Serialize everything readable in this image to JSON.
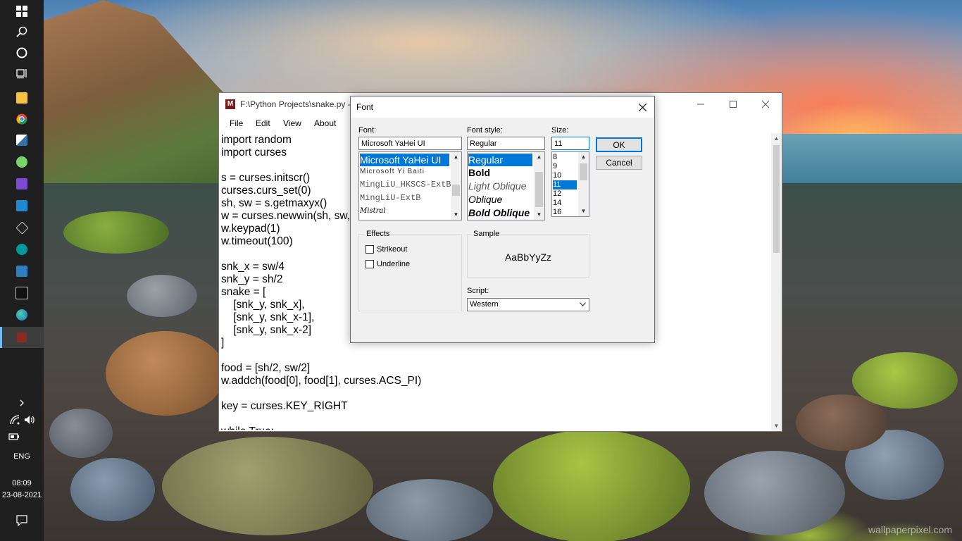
{
  "taskbar": {
    "icons": [
      "windows-start-icon",
      "search-icon",
      "cortana-icon",
      "task-view-icon",
      "file-explorer-icon",
      "chrome-icon",
      "python-idle-icon",
      "github-desktop-icon",
      "visual-studio-icon",
      "vscode-icon",
      "inkscape-icon",
      "arduino-icon",
      "pycharm-icon",
      "cmd-icon",
      "edge-icon",
      "text-editor-icon"
    ],
    "language": "ENG",
    "time": "08:09",
    "date": "23-08-2021"
  },
  "editor": {
    "title": "F:\\Python Projects\\snake.py -",
    "menu": [
      "File",
      "Edit",
      "View",
      "About"
    ],
    "lines": [
      "import random",
      "import curses",
      "",
      "s = curses.initscr()",
      "curses.curs_set(0)",
      "sh, sw = s.getmaxyx()",
      "w = curses.newwin(sh, sw,",
      "w.keypad(1)",
      "w.timeout(100)",
      "",
      "snk_x = sw/4",
      "snk_y = sh/2",
      "snake = [",
      "    [snk_y, snk_x],",
      "    [snk_y, snk_x-1],",
      "    [snk_y, snk_x-2]",
      "]",
      "",
      "food = [sh/2, sw/2]",
      "w.addch(food[0], food[1], curses.ACS_PI)",
      "",
      "key = curses.KEY_RIGHT",
      "",
      "while True:"
    ]
  },
  "font_dialog": {
    "title": "Font",
    "font_label": "Font:",
    "font_value": "Microsoft YaHei UI",
    "font_list": [
      "Microsoft YaHei UI",
      "Microsoft Yi Baiti",
      "MingLiU_HKSCS-ExtB",
      "MingLiU-ExtB",
      "Mistral"
    ],
    "style_label": "Font style:",
    "style_value": "Regular",
    "style_list": [
      "Regular",
      "Bold",
      "Light Oblique",
      "Oblique",
      "Bold Oblique"
    ],
    "size_label": "Size:",
    "size_value": "11",
    "size_list": [
      "8",
      "9",
      "10",
      "11",
      "12",
      "14",
      "16"
    ],
    "ok_label": "OK",
    "cancel_label": "Cancel",
    "effects_label": "Effects",
    "strikeout_label": "Strikeout",
    "underline_label": "Underline",
    "sample_label": "Sample",
    "sample_text": "AaBbYyZz",
    "script_label": "Script:",
    "script_value": "Western"
  },
  "watermark": "wallpaperpixel.com"
}
